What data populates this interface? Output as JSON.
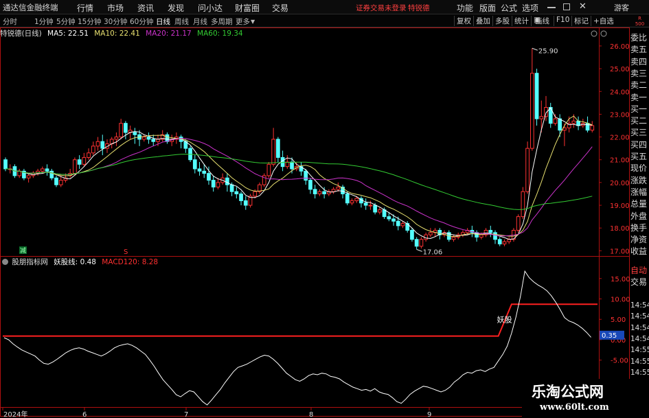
{
  "app": {
    "title": "通达信金融终端",
    "menu": [
      "行情",
      "市场",
      "资讯",
      "发现",
      "问小达",
      "财富圈",
      "交易"
    ],
    "notice": "证券交易未登录",
    "stock_link": "特锐德",
    "right_menu": [
      "功能",
      "版面",
      "公式",
      "选项"
    ],
    "guest": "游客"
  },
  "toolbar": {
    "periods": [
      "分时",
      "1分钟",
      "5分钟",
      "15分钟",
      "30分钟",
      "60分钟",
      "日线",
      "周线",
      "月线",
      "多周期",
      "更多"
    ],
    "active_period": "日线",
    "right_buttons": [
      "复权",
      "叠加",
      "多股",
      "统计",
      "画线",
      "F10",
      "标记",
      "+自选"
    ]
  },
  "main_panel": {
    "stock_title": "特锐德(日线)",
    "ma": [
      {
        "label": "MA5: 22.51",
        "color": "#ffffff"
      },
      {
        "label": "MA10: 22.41",
        "color": "#e8e070"
      },
      {
        "label": "MA20: 21.17",
        "color": "#cc33cc"
      },
      {
        "label": "MA60: 19.34",
        "color": "#33cc33"
      }
    ],
    "high_label": "25.90",
    "low_label": "17.06",
    "marker_green": "减",
    "marker_red": "S"
  },
  "sub_panel": {
    "title": "股朋指标网",
    "line1": "妖股线: 0.48",
    "line2": "MACD120: 8.28",
    "annotation": "妖股",
    "current_value": "0.35"
  },
  "price_axis": [
    "26.00",
    "25.00",
    "24.00",
    "23.00",
    "22.00",
    "21.00",
    "20.00",
    "19.00",
    "18.00",
    "17.00"
  ],
  "sub_axis": [
    "15.00",
    "10.00",
    "5.00",
    "0.00",
    "-5.00"
  ],
  "date_axis": [
    "2024年",
    "6",
    "7",
    "8",
    "9"
  ],
  "side_panel": {
    "top_labels": [
      "R",
      "500"
    ],
    "items": [
      "委比",
      "卖五",
      "卖四",
      "卖三",
      "卖二",
      "卖一",
      "买一",
      "买二",
      "买三",
      "买四",
      "买五",
      "现价",
      "涨跌",
      "涨幅",
      "总量",
      "外盘",
      "换手",
      "净资",
      "收益"
    ],
    "lower_items": [
      "自动",
      "交易"
    ],
    "times": [
      "14:54",
      "14:54",
      "14:54",
      "14:54",
      "14:55",
      "14:55",
      "14:55"
    ]
  },
  "watermark": {
    "text": "乐淘公式网",
    "url": "www.60lt.com"
  },
  "colors": {
    "up": "#ff3232",
    "down": "#54ffff",
    "ma5": "#ffffff",
    "ma10": "#e8e070",
    "ma20": "#cc33cc",
    "ma60": "#33cc33",
    "frame": "#b01010",
    "notice": "#ff4040",
    "sub_line": "#ffffff",
    "level_line": "#ff2020"
  },
  "chart_data": {
    "type": "candlestick",
    "ylim": [
      16.8,
      26.3
    ],
    "candles": [
      [
        21.0,
        21.1,
        20.6,
        20.5
      ],
      [
        20.6,
        20.8,
        20.6,
        20.4
      ],
      [
        20.7,
        20.8,
        20.3,
        20.2
      ],
      [
        20.3,
        20.6,
        20.5,
        20.2
      ],
      [
        20.5,
        20.6,
        20.2,
        20.1
      ],
      [
        20.2,
        20.4,
        20.3,
        20.0
      ],
      [
        20.3,
        20.5,
        20.4,
        20.2
      ],
      [
        20.4,
        20.6,
        20.5,
        20.3
      ],
      [
        20.5,
        20.7,
        20.6,
        20.4
      ],
      [
        20.6,
        20.8,
        20.5,
        20.3
      ],
      [
        20.5,
        20.6,
        20.2,
        20.1
      ],
      [
        20.2,
        20.3,
        19.9,
        19.8
      ],
      [
        19.9,
        20.3,
        20.1,
        19.8
      ],
      [
        20.1,
        20.4,
        20.2,
        20.0
      ],
      [
        20.3,
        20.6,
        20.4,
        20.2
      ],
      [
        20.4,
        21.1,
        21.0,
        20.3
      ],
      [
        21.0,
        21.2,
        20.8,
        20.6
      ],
      [
        20.8,
        21.3,
        21.1,
        20.7
      ],
      [
        21.1,
        21.5,
        21.3,
        21.0
      ],
      [
        21.3,
        21.8,
        21.6,
        21.2
      ],
      [
        21.6,
        22.0,
        21.8,
        21.4
      ],
      [
        21.8,
        22.1,
        21.5,
        21.2
      ],
      [
        21.5,
        21.9,
        21.7,
        21.3
      ],
      [
        21.7,
        22.0,
        21.9,
        21.5
      ],
      [
        21.9,
        22.2,
        22.0,
        21.6
      ],
      [
        22.0,
        22.8,
        22.6,
        21.9
      ],
      [
        22.6,
        22.7,
        22.2,
        21.9
      ],
      [
        22.2,
        22.5,
        22.3,
        21.9
      ],
      [
        22.2,
        22.4,
        22.1,
        21.7
      ],
      [
        22.1,
        22.3,
        21.9,
        21.6
      ],
      [
        21.9,
        22.1,
        22.0,
        21.8
      ],
      [
        22.0,
        22.2,
        21.9,
        21.7
      ],
      [
        21.9,
        22.1,
        21.8,
        21.6
      ],
      [
        21.8,
        22.1,
        21.9,
        21.6
      ],
      [
        21.9,
        22.3,
        22.1,
        21.8
      ],
      [
        22.1,
        22.2,
        21.8,
        21.7
      ],
      [
        21.8,
        22.1,
        21.9,
        21.6
      ],
      [
        21.9,
        22.2,
        22.0,
        21.7
      ],
      [
        22.0,
        22.1,
        21.8,
        21.5
      ],
      [
        21.8,
        21.9,
        21.5,
        21.3
      ],
      [
        21.5,
        21.6,
        21.0,
        20.9
      ],
      [
        21.0,
        21.2,
        20.6,
        20.4
      ],
      [
        20.6,
        20.9,
        20.5,
        20.3
      ],
      [
        20.5,
        20.8,
        20.4,
        20.2
      ],
      [
        20.4,
        20.7,
        20.1,
        19.9
      ],
      [
        20.1,
        20.3,
        19.8,
        19.6
      ],
      [
        19.8,
        20.2,
        20.0,
        19.7
      ],
      [
        20.0,
        20.4,
        20.2,
        19.9
      ],
      [
        20.2,
        20.4,
        19.9,
        19.6
      ],
      [
        19.9,
        20.0,
        19.6,
        19.4
      ],
      [
        19.6,
        19.8,
        19.5,
        19.3
      ],
      [
        19.5,
        19.6,
        19.2,
        19.0
      ],
      [
        19.2,
        19.4,
        19.0,
        18.8
      ],
      [
        19.0,
        19.5,
        19.4,
        18.9
      ],
      [
        19.4,
        19.7,
        19.6,
        19.3
      ],
      [
        19.6,
        20.0,
        19.9,
        19.5
      ],
      [
        19.9,
        20.4,
        20.3,
        19.8
      ],
      [
        20.3,
        20.9,
        20.8,
        20.2
      ],
      [
        20.8,
        22.4,
        21.9,
        20.7
      ],
      [
        21.9,
        22.0,
        21.1,
        20.9
      ],
      [
        21.1,
        21.4,
        20.7,
        20.5
      ],
      [
        20.7,
        21.2,
        20.9,
        20.6
      ],
      [
        20.9,
        21.1,
        20.6,
        20.4
      ],
      [
        20.6,
        20.9,
        20.7,
        20.5
      ],
      [
        20.7,
        20.9,
        20.5,
        20.3
      ],
      [
        20.5,
        20.6,
        20.1,
        19.9
      ],
      [
        20.1,
        20.2,
        19.7,
        19.5
      ],
      [
        19.7,
        19.9,
        19.5,
        19.3
      ],
      [
        19.5,
        19.7,
        19.6,
        19.4
      ],
      [
        19.6,
        19.8,
        19.5,
        19.3
      ],
      [
        19.5,
        19.7,
        19.6,
        19.4
      ],
      [
        19.6,
        19.8,
        19.7,
        19.5
      ],
      [
        19.7,
        20.0,
        19.8,
        19.6
      ],
      [
        19.8,
        19.9,
        19.5,
        19.3
      ],
      [
        19.5,
        19.6,
        19.1,
        19.0
      ],
      [
        19.1,
        19.3,
        19.2,
        19.0
      ],
      [
        19.2,
        19.4,
        19.3,
        19.1
      ],
      [
        19.3,
        19.4,
        19.1,
        18.9
      ],
      [
        19.1,
        19.3,
        19.0,
        18.8
      ],
      [
        19.0,
        19.2,
        19.0,
        18.8
      ],
      [
        19.0,
        19.1,
        18.7,
        18.6
      ],
      [
        18.7,
        18.9,
        18.8,
        18.6
      ],
      [
        18.8,
        18.9,
        18.5,
        18.4
      ],
      [
        18.5,
        18.7,
        18.4,
        18.3
      ],
      [
        18.4,
        18.6,
        18.3,
        18.1
      ],
      [
        18.3,
        18.5,
        18.1,
        17.9
      ],
      [
        18.1,
        18.3,
        18.2,
        18.0
      ],
      [
        18.2,
        18.3,
        17.9,
        17.8
      ],
      [
        17.9,
        18.0,
        17.5,
        17.4
      ],
      [
        17.5,
        17.6,
        17.2,
        17.06
      ],
      [
        17.2,
        17.6,
        17.5,
        17.1
      ],
      [
        17.5,
        17.8,
        17.7,
        17.4
      ],
      [
        17.7,
        18.0,
        17.8,
        17.6
      ],
      [
        17.8,
        18.0,
        17.9,
        17.6
      ],
      [
        17.9,
        18.0,
        17.7,
        17.5
      ],
      [
        17.7,
        17.9,
        17.8,
        17.6
      ],
      [
        17.8,
        17.9,
        17.5,
        17.4
      ],
      [
        17.5,
        17.7,
        17.6,
        17.4
      ],
      [
        17.6,
        17.8,
        17.7,
        17.5
      ],
      [
        17.7,
        17.9,
        17.8,
        17.6
      ],
      [
        17.8,
        18.0,
        17.9,
        17.7
      ],
      [
        17.9,
        18.1,
        17.8,
        17.6
      ],
      [
        17.8,
        17.9,
        17.6,
        17.4
      ],
      [
        17.6,
        17.8,
        17.7,
        17.5
      ],
      [
        17.7,
        18.0,
        17.9,
        17.6
      ],
      [
        17.9,
        18.1,
        17.8,
        17.6
      ],
      [
        17.8,
        17.9,
        17.5,
        17.3
      ],
      [
        17.5,
        17.6,
        17.3,
        17.2
      ],
      [
        17.3,
        17.5,
        17.4,
        17.2
      ],
      [
        17.4,
        17.6,
        17.5,
        17.3
      ],
      [
        17.5,
        18.0,
        17.9,
        17.4
      ],
      [
        17.9,
        18.6,
        18.5,
        17.8
      ],
      [
        18.5,
        19.8,
        19.6,
        18.4
      ],
      [
        19.6,
        21.8,
        21.5,
        19.5
      ],
      [
        21.5,
        25.9,
        24.8,
        21.4
      ],
      [
        24.8,
        25.0,
        22.8,
        22.5
      ],
      [
        22.8,
        23.6,
        22.9,
        22.2
      ],
      [
        22.9,
        23.8,
        23.3,
        22.7
      ],
      [
        23.3,
        23.5,
        22.6,
        22.4
      ],
      [
        22.6,
        23.0,
        22.8,
        22.5
      ],
      [
        22.8,
        23.0,
        22.3,
        22.0
      ],
      [
        22.3,
        22.6,
        22.4,
        21.6
      ],
      [
        22.4,
        22.9,
        22.6,
        22.2
      ],
      [
        22.6,
        23.0,
        22.7,
        22.4
      ],
      [
        22.7,
        22.9,
        22.5,
        22.3
      ],
      [
        22.5,
        22.8,
        22.6,
        22.4
      ],
      [
        22.6,
        22.9,
        22.3,
        22.2
      ],
      [
        22.3,
        22.7,
        22.5,
        22.2
      ]
    ],
    "ma_series": [
      "MA5",
      "MA10",
      "MA20",
      "MA60"
    ],
    "sub_series": {
      "name": "妖股线",
      "values": [
        0.5,
        0,
        -1,
        -1.8,
        -2.5,
        -3,
        -3.5,
        -4,
        -5,
        -5.8,
        -6,
        -5.5,
        -4.8,
        -4,
        -3.2,
        -2.6,
        -2.2,
        -2,
        -2.3,
        -2.8,
        -3.2,
        -3.6,
        -4,
        -3.5,
        -2.8,
        -2.0,
        -1.5,
        -1.2,
        -1.0,
        -1.4,
        -2.0,
        -2.8,
        -3.6,
        -5.0,
        -6.5,
        -8.2,
        -9.8,
        -11.0,
        -12.2,
        -13.5,
        -14.0,
        -13.2,
        -12.5,
        -12.8,
        -14.0,
        -15.2,
        -16.0,
        -14.8,
        -13.5,
        -12.2,
        -10.6,
        -9.2,
        -7.8,
        -6.8,
        -6.4,
        -6.0,
        -5.4,
        -4.8,
        -4.2,
        -3.8,
        -4.0,
        -4.8,
        -5.8,
        -7.0,
        -8.2,
        -9.0,
        -9.8,
        -10.2,
        -9.6,
        -8.8,
        -8.4,
        -8.6,
        -8.2,
        -8.4,
        -9.0,
        -9.2,
        -9.6,
        -10.4,
        -11.0,
        -11.6,
        -12.0,
        -12.4,
        -12.2,
        -12.6,
        -12.0,
        -12.8,
        -13.2,
        -13.4,
        -14.2,
        -15.2,
        -15.6,
        -14.6,
        -13.4,
        -12.6,
        -12.0,
        -11.4,
        -11.6,
        -12.0,
        -12.4,
        -12.8,
        -12.4,
        -11.6,
        -10.4,
        -9.6,
        -8.6,
        -8.0,
        -8.2,
        -7.6,
        -7.4,
        -7.8,
        -7.2,
        -6.8,
        -5.2,
        -3.6,
        -1.6,
        1.6,
        5.6,
        10.6,
        16.8,
        15.2,
        14.2,
        13.4,
        12.8,
        12.0,
        10.8,
        9.2,
        7.4,
        5.4,
        4.6,
        4.2,
        3.6,
        2.8,
        1.8,
        0.6
      ],
      "level_values": [
        {
          "from_index": 0,
          "to_index": 112,
          "value": 0.9
        },
        {
          "from_index": 115,
          "to_index": 131,
          "value": 8.7
        }
      ]
    },
    "sub_ylim": [
      -16,
      18.5
    ]
  }
}
